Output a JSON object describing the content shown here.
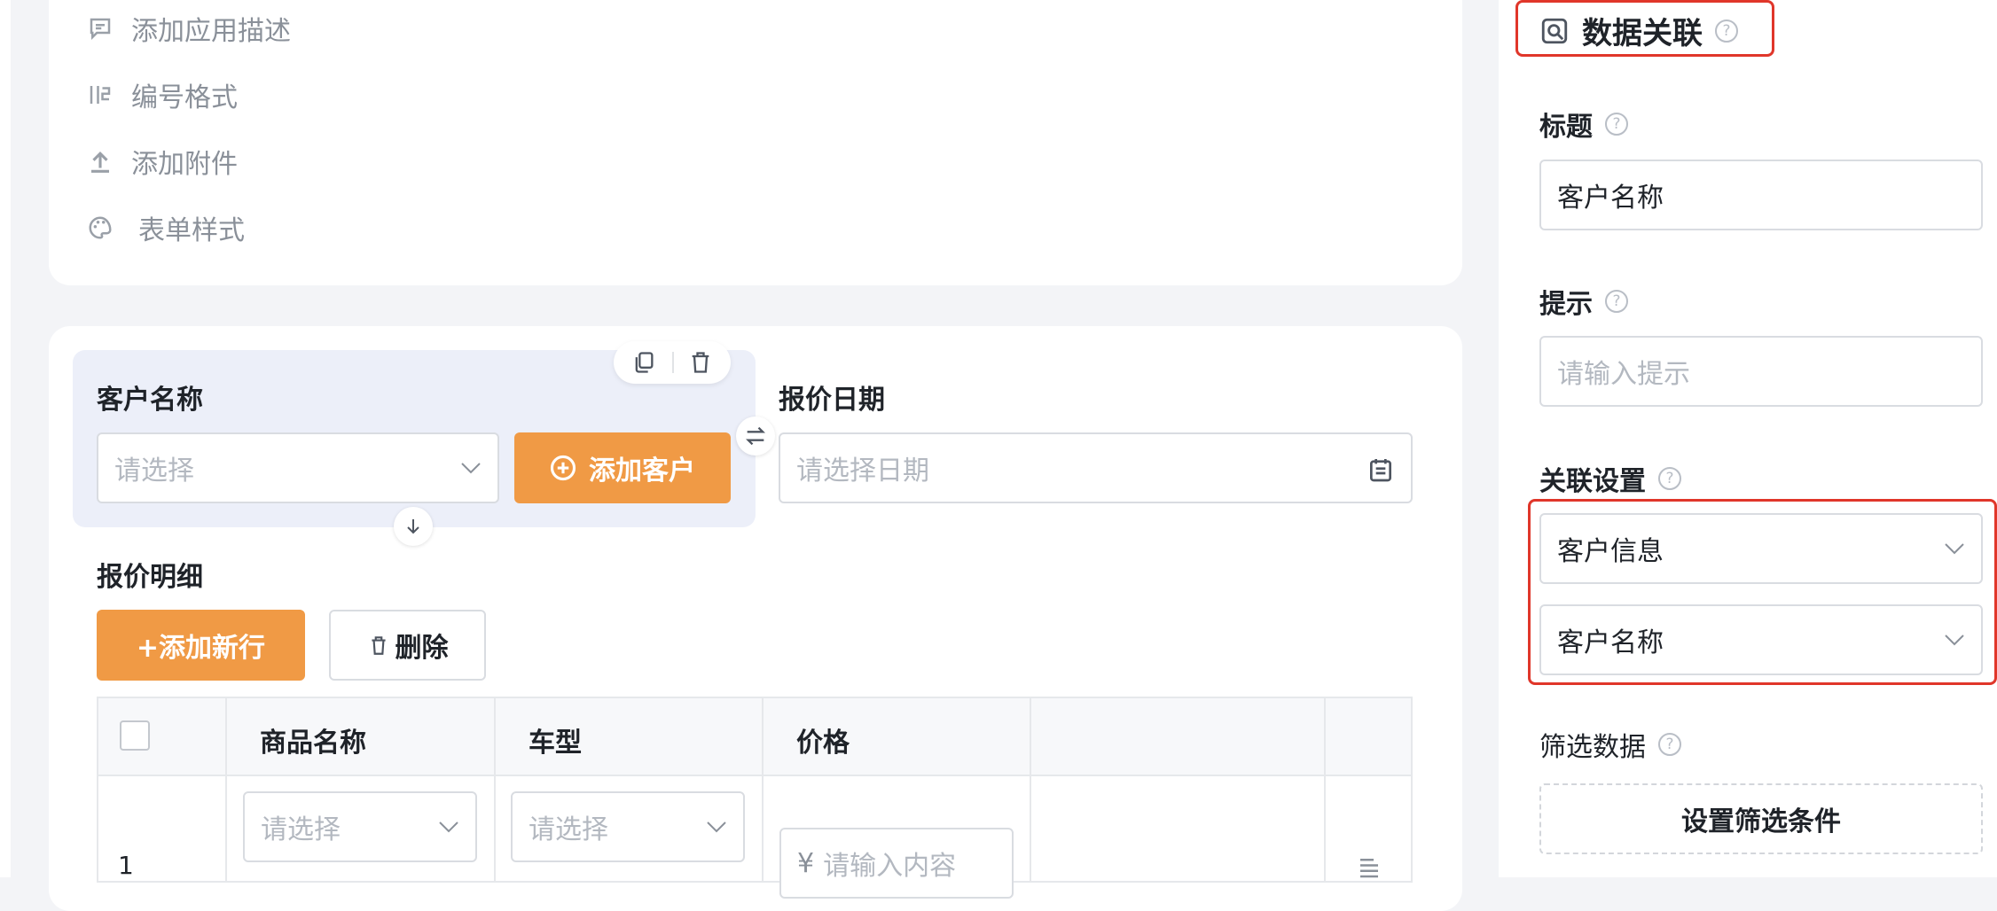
{
  "form_settings_menu": {
    "items": [
      {
        "label": "添加应用描述",
        "icon": "comment-icon"
      },
      {
        "label": "编号格式",
        "icon": "number-format-icon"
      },
      {
        "label": "添加附件",
        "icon": "upload-icon"
      },
      {
        "label": "表单样式",
        "icon": "palette-icon"
      }
    ]
  },
  "form": {
    "customer_field": {
      "label": "客户名称",
      "placeholder": "请选择",
      "add_button": "添加客户"
    },
    "quote_date_field": {
      "label": "报价日期",
      "placeholder": "请选择日期"
    },
    "quote_detail": {
      "label": "报价明细",
      "add_row_button": "+添加新行",
      "delete_button": "删除",
      "columns": [
        "商品名称",
        "车型",
        "价格"
      ],
      "rows": [
        {
          "index": "1",
          "product_placeholder": "请选择",
          "model_placeholder": "请选择",
          "price_placeholder": "请输入内容",
          "currency": "¥"
        }
      ]
    }
  },
  "right_panel": {
    "header_title": "数据关联",
    "title_label": "标题",
    "title_value": "客户名称",
    "hint_label": "提示",
    "hint_placeholder": "请输入提示",
    "relation_label": "关联设置",
    "relation_source": "客户信息",
    "relation_field": "客户名称",
    "filter_label": "筛选数据",
    "filter_button": "设置筛选条件"
  },
  "colors": {
    "accent_orange": "#f09a45",
    "highlight_red": "#e0362a",
    "selected_bg": "#eceff9"
  }
}
